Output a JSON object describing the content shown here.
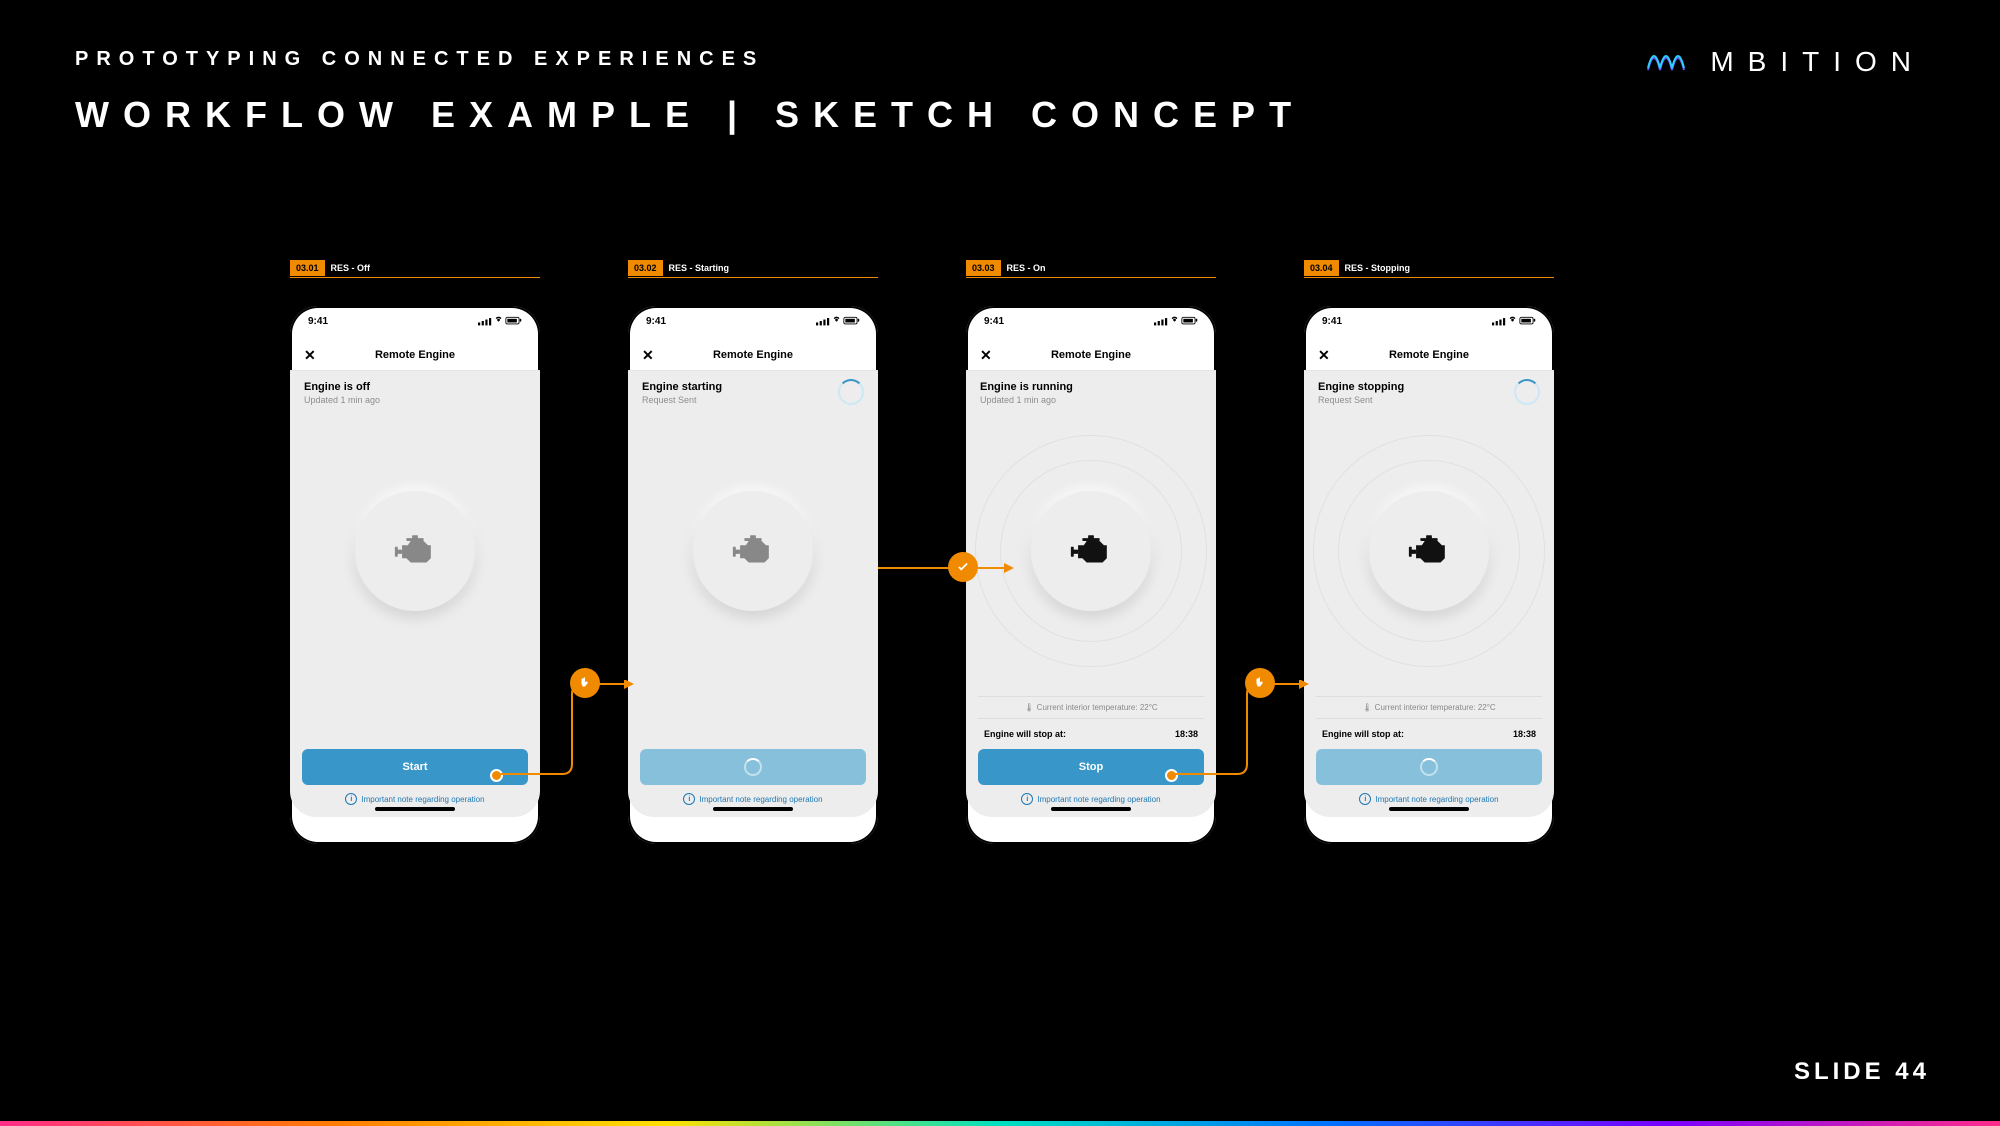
{
  "slide": {
    "kicker": "PROTOTYPING CONNECTED EXPERIENCES",
    "title": "WORKFLOW EXAMPLE | SKETCH CONCEPT",
    "brand": "MBITION",
    "number": "SLIDE 44"
  },
  "common": {
    "time": "9:41",
    "screen_title": "Remote Engine",
    "close": "✕",
    "note": "Important note regarding operation",
    "stop_at_label": "Engine will stop at:",
    "stop_at_value": "18:38",
    "temp": "🌡  Current interior temperature:  22°C"
  },
  "screens": [
    {
      "tag_num": "03.01",
      "tag_label": "RES - Off",
      "header": "Engine is off",
      "sub": "Updated 1 min ago",
      "engine_dark": false,
      "rings": false,
      "spinner_hdr": false,
      "show_temp": false,
      "show_stop": false,
      "btn_kind": "text",
      "btn_label": "Start"
    },
    {
      "tag_num": "03.02",
      "tag_label": "RES - Starting",
      "header": "Engine starting",
      "sub": "Request Sent",
      "engine_dark": false,
      "rings": false,
      "spinner_hdr": true,
      "show_temp": false,
      "show_stop": false,
      "btn_kind": "spinner",
      "btn_label": ""
    },
    {
      "tag_num": "03.03",
      "tag_label": "RES - On",
      "header": "Engine is running",
      "sub": "Updated 1 min ago",
      "engine_dark": true,
      "rings": true,
      "spinner_hdr": false,
      "show_temp": true,
      "show_stop": true,
      "btn_kind": "text",
      "btn_label": "Stop"
    },
    {
      "tag_num": "03.04",
      "tag_label": "RES - Stopping",
      "header": "Engine stopping",
      "sub": "Request Sent",
      "engine_dark": true,
      "rings": true,
      "spinner_hdr": true,
      "show_temp": true,
      "show_stop": true,
      "btn_kind": "spinner",
      "btn_label": ""
    }
  ],
  "colors": {
    "accent": "#f08a00",
    "button": "#3896c8"
  }
}
